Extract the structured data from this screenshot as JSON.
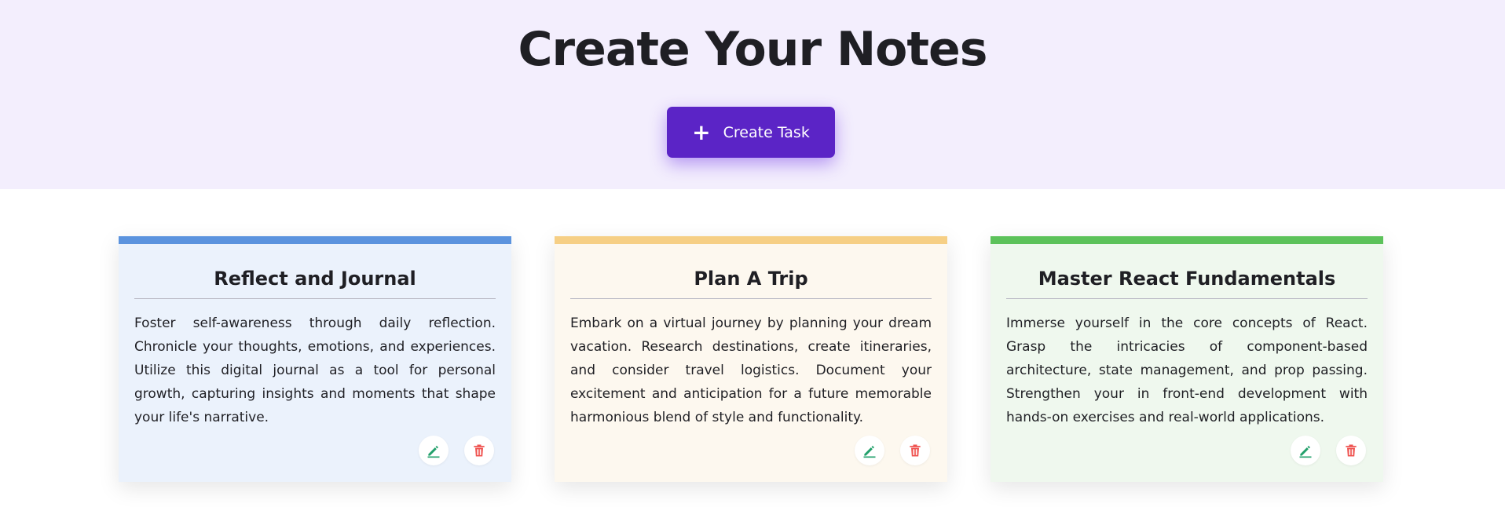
{
  "header": {
    "title": "Create Your Notes",
    "create_button_label": "Create Task",
    "create_button_icon": "plus-icon",
    "accent_color": "#5b24c6"
  },
  "notes": [
    {
      "title": "Reflect and Journal",
      "description": "Foster self-awareness through daily reflection. Chronicle your thoughts, emotions, and experiences. Utilize this digital journal as a tool for personal growth, capturing insights and moments that shape your life's narrative.",
      "accent_color": "#5b93de",
      "background_color": "#ebf2fc",
      "edit_icon": "pencil-icon",
      "delete_icon": "trash-icon"
    },
    {
      "title": "Plan A Trip",
      "description": "Embark on a virtual journey by planning your dream vacation. Research destinations, create itineraries, and consider travel logistics. Document your excitement and anticipation for a future memorable harmonious blend of style and functionality.",
      "accent_color": "#f6cf85",
      "background_color": "#fdf8ef",
      "edit_icon": "pencil-icon",
      "delete_icon": "trash-icon"
    },
    {
      "title": "Master React Fundamentals",
      "description": "Immerse yourself in the core concepts of React. Grasp the intricacies of component-based architecture, state management, and prop passing. Strengthen your in front-end development with hands-on exercises and real-world applications.",
      "accent_color": "#5cc25a",
      "background_color": "#eff8ee",
      "edit_icon": "pencil-icon",
      "delete_icon": "trash-icon"
    }
  ],
  "icon_colors": {
    "edit": "#22a06b",
    "delete": "#ef5350"
  }
}
